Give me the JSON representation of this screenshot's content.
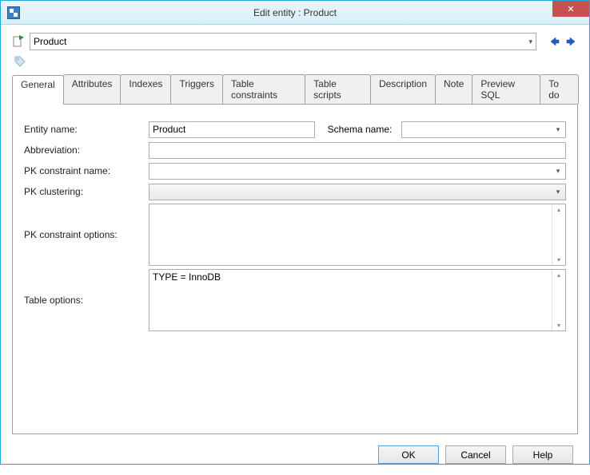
{
  "window": {
    "title": "Edit entity : Product"
  },
  "toolbar": {
    "entity_selected": "Product"
  },
  "tabs": [
    {
      "label": "General"
    },
    {
      "label": "Attributes"
    },
    {
      "label": "Indexes"
    },
    {
      "label": "Triggers"
    },
    {
      "label": "Table constraints"
    },
    {
      "label": "Table scripts"
    },
    {
      "label": "Description"
    },
    {
      "label": "Note"
    },
    {
      "label": "Preview SQL"
    },
    {
      "label": "To do"
    }
  ],
  "form": {
    "entity_name_label": "Entity name:",
    "entity_name_value": "Product",
    "schema_name_label": "Schema name:",
    "schema_name_value": "",
    "abbreviation_label": "Abbreviation:",
    "abbreviation_value": "",
    "pk_constraint_name_label": "PK constraint name:",
    "pk_constraint_name_value": "",
    "pk_clustering_label": "PK clustering:",
    "pk_clustering_value": "",
    "pk_constraint_options_label": "PK constraint options:",
    "pk_constraint_options_value": "",
    "table_options_label": "Table options:",
    "table_options_value": "TYPE = InnoDB"
  },
  "buttons": {
    "ok": "OK",
    "cancel": "Cancel",
    "help": "Help"
  }
}
